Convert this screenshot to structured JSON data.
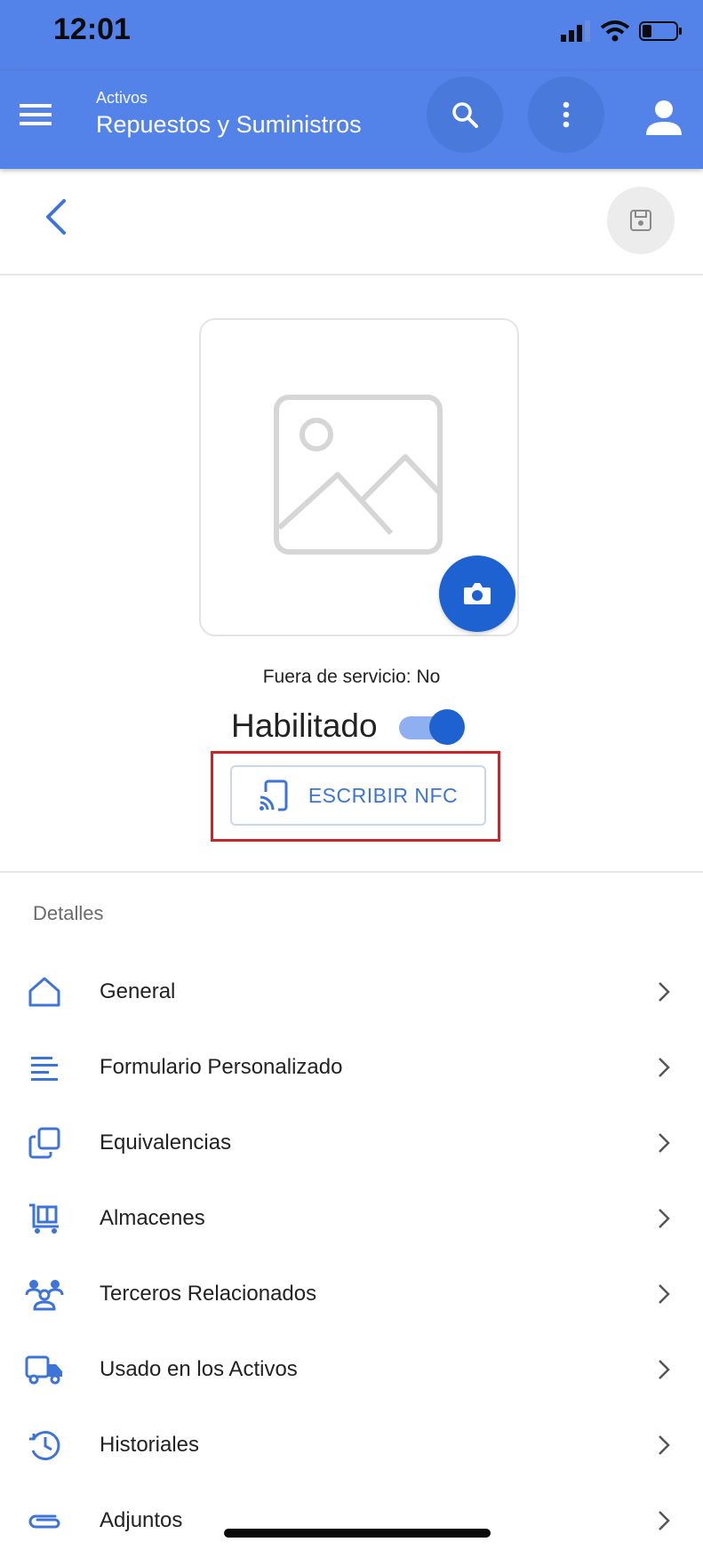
{
  "status_bar": {
    "time": "12:01"
  },
  "app_bar": {
    "subtitle": "Activos",
    "title": "Repuestos y Suministros",
    "accent_color": "#5383e8"
  },
  "toolbar": {
    "back_icon": "chevron-left-icon",
    "save_icon": "save-icon"
  },
  "asset": {
    "image_placeholder_icon": "image-icon",
    "camera_icon": "camera-icon",
    "out_of_service": "Fuera de servicio: No",
    "enabled_label": "Habilitado",
    "enabled": true,
    "nfc_button_label": "ESCRIBIR NFC",
    "nfc_icon": "nfc-icon"
  },
  "details": {
    "section_title": "Detalles",
    "items": [
      {
        "label": "General",
        "icon": "home-icon"
      },
      {
        "label": "Formulario Personalizado",
        "icon": "lines-icon"
      },
      {
        "label": "Equivalencias",
        "icon": "copy-icon"
      },
      {
        "label": "Almacenes",
        "icon": "warehouse-cart-icon"
      },
      {
        "label": "Terceros Relacionados",
        "icon": "people-icon"
      },
      {
        "label": "Usado en los Activos",
        "icon": "truck-icon"
      },
      {
        "label": "Historiales",
        "icon": "history-icon"
      },
      {
        "label": "Adjuntos",
        "icon": "paperclip-icon"
      }
    ]
  }
}
